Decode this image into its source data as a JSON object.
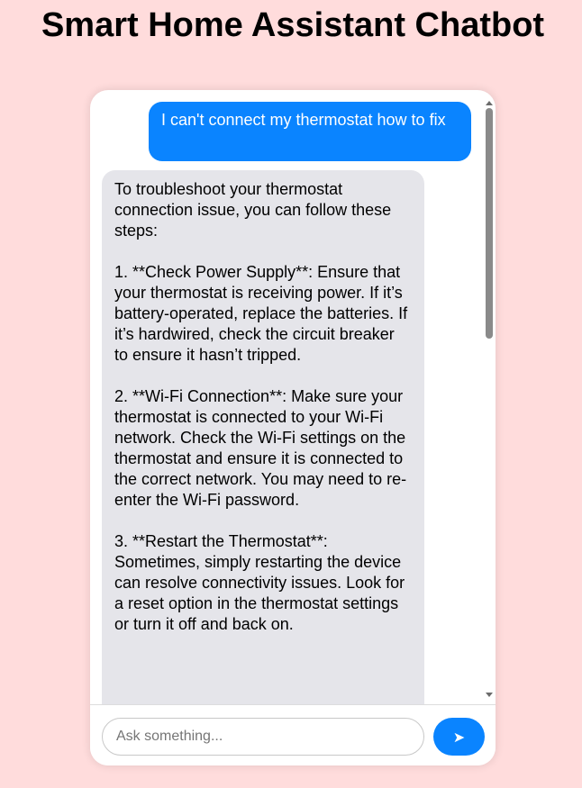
{
  "page": {
    "title": "Smart Home Assistant Chatbot"
  },
  "chat": {
    "messages": [
      {
        "role": "user",
        "text": "I can't connect my thermostat how to fix"
      },
      {
        "role": "bot",
        "text": "To troubleshoot your thermostat connection issue, you can follow these steps:\n\n1. **Check Power Supply**: Ensure that your thermostat is receiving power. If it’s battery-operated, replace the batteries. If it’s hardwired, check the circuit breaker to ensure it hasn’t tripped.\n\n2. **Wi-Fi Connection**: Make sure your thermostat is connected to your Wi-Fi network. Check the Wi-Fi settings on the thermostat and ensure it is connected to the correct network. You may need to re-enter the Wi-Fi password.\n\n3. **Restart the Thermostat**: Sometimes, simply restarting the device can resolve connectivity issues. Look for a reset option in the thermostat settings or turn it off and back on."
      }
    ]
  },
  "input": {
    "value": "",
    "placeholder": "Ask something..."
  },
  "send_button": {
    "icon": "send-arrow-icon",
    "glyph": "➤"
  },
  "colors": {
    "background": "#ffdcdc",
    "user_bubble": "#0a84ff",
    "bot_bubble": "#e5e5ea",
    "send_button": "#0a84ff"
  }
}
